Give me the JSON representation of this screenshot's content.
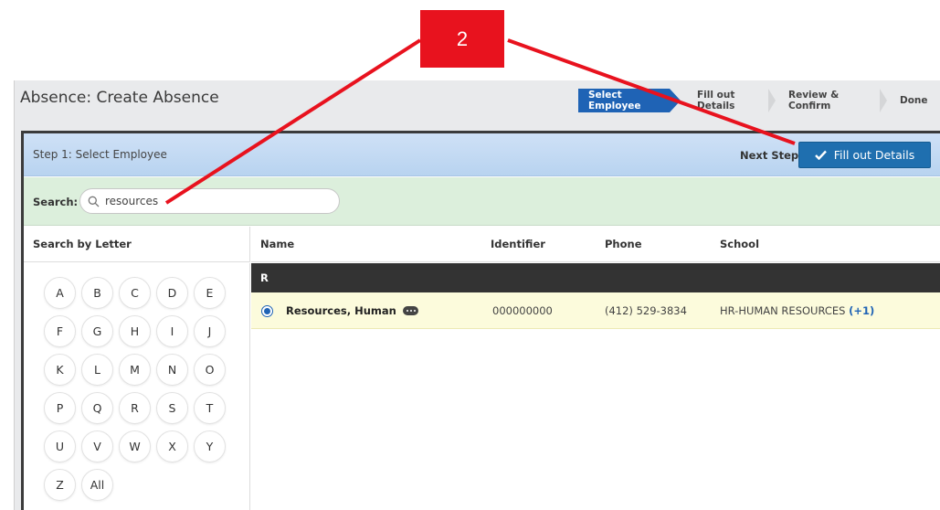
{
  "callout": {
    "number": "2",
    "color": "#e8121e"
  },
  "app": {
    "title": "Absence: Create Absence"
  },
  "wizard": {
    "steps": [
      {
        "label": "Select Employee",
        "active": true
      },
      {
        "label": "Fill out Details",
        "active": false
      },
      {
        "label": "Review & Confirm",
        "active": false
      },
      {
        "label": "Done",
        "active": false
      }
    ]
  },
  "step_bar": {
    "label": "Step 1: Select Employee",
    "next_label": "Next Step:",
    "next_button": "Fill out Details",
    "next_icon": "checkmark-icon"
  },
  "search": {
    "label": "Search:",
    "value": "resources",
    "icon": "search-icon"
  },
  "letters": {
    "header": "Search by Letter",
    "rows": [
      [
        "A",
        "B",
        "C",
        "D",
        "E"
      ],
      [
        "F",
        "G",
        "H",
        "I",
        "J"
      ],
      [
        "K",
        "L",
        "M",
        "N",
        "O"
      ],
      [
        "P",
        "Q",
        "R",
        "S",
        "T"
      ],
      [
        "U",
        "V",
        "W",
        "X",
        "Y"
      ],
      [
        "Z",
        "All"
      ]
    ]
  },
  "table": {
    "columns": [
      "Name",
      "Identifier",
      "Phone",
      "School"
    ],
    "group": "R",
    "rows": [
      {
        "selected": true,
        "name": "Resources, Human",
        "identifier": "000000000",
        "phone": "(412) 529-3834",
        "school": "HR-HUMAN RESOURCES",
        "school_extra": "(+1)"
      }
    ]
  },
  "colors": {
    "accent": "#1f63b5",
    "step_bar": "#c5dbf3",
    "search_bar": "#dcefdc",
    "selected_row": "#fcfbdc",
    "group_row": "#333333"
  }
}
